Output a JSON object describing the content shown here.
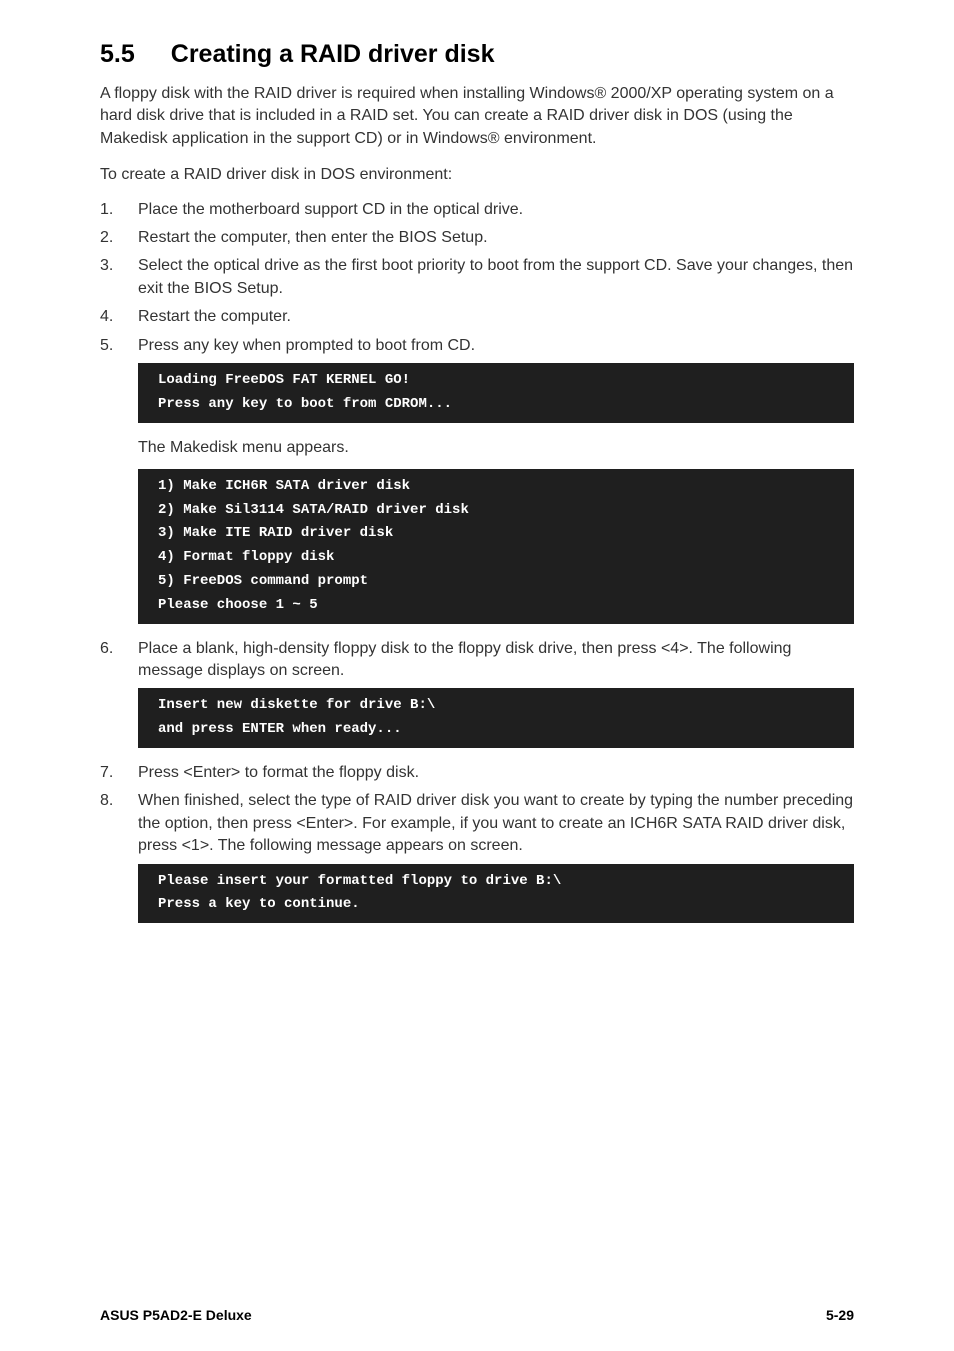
{
  "heading": {
    "number": "5.5",
    "title": "Creating a RAID driver disk"
  },
  "intro_para": "A floppy disk with the RAID driver is required when installing Windows® 2000/XP operating system on a hard disk drive that is included in a RAID set. You can create a RAID driver disk in DOS (using the Makedisk application in the support CD) or in Windows® environment.",
  "list_intro": "To create a RAID driver disk in DOS environment:",
  "steps_a": [
    {
      "num": "1.",
      "txt": "Place the motherboard support CD in the optical drive."
    },
    {
      "num": "2.",
      "txt": "Restart the computer, then enter the BIOS Setup."
    },
    {
      "num": "3.",
      "txt": "Select the optical drive as the first boot priority to boot from the support CD. Save your changes, then exit the BIOS Setup."
    },
    {
      "num": "4.",
      "txt": "Restart the computer."
    },
    {
      "num": "5.",
      "txt": "Press any key when prompted to boot from CD."
    }
  ],
  "code1": "Loading FreeDOS FAT KERNEL GO!\nPress any key to boot from CDROM...",
  "sub_note1": "The Makedisk menu appears.",
  "code2": "1) Make ICH6R SATA driver disk\n2) Make Sil3114 SATA/RAID driver disk\n3) Make ITE RAID driver disk\n4) Format floppy disk\n5) FreeDOS command prompt\nPlease choose 1 ~ 5",
  "step6": {
    "num": "6.",
    "txt": "Place a blank, high-density floppy disk to the floppy disk drive, then press <4>. The following message displays on screen."
  },
  "code3": "Insert new diskette for drive B:\\\nand press ENTER when ready...",
  "steps_b": [
    {
      "num": "7.",
      "txt": "Press <Enter> to format the floppy disk."
    },
    {
      "num": "8.",
      "txt": "When finished, select the type of RAID driver disk you want to create by typing the number preceding the option, then press <Enter>. For example, if you want to create an ICH6R SATA RAID driver disk, press <1>. The following message appears on screen."
    }
  ],
  "code4": "Please insert your formatted floppy to drive B:\\\nPress a key to continue.",
  "footer": {
    "left": "ASUS P5AD2-E Deluxe",
    "right": "5-29"
  }
}
